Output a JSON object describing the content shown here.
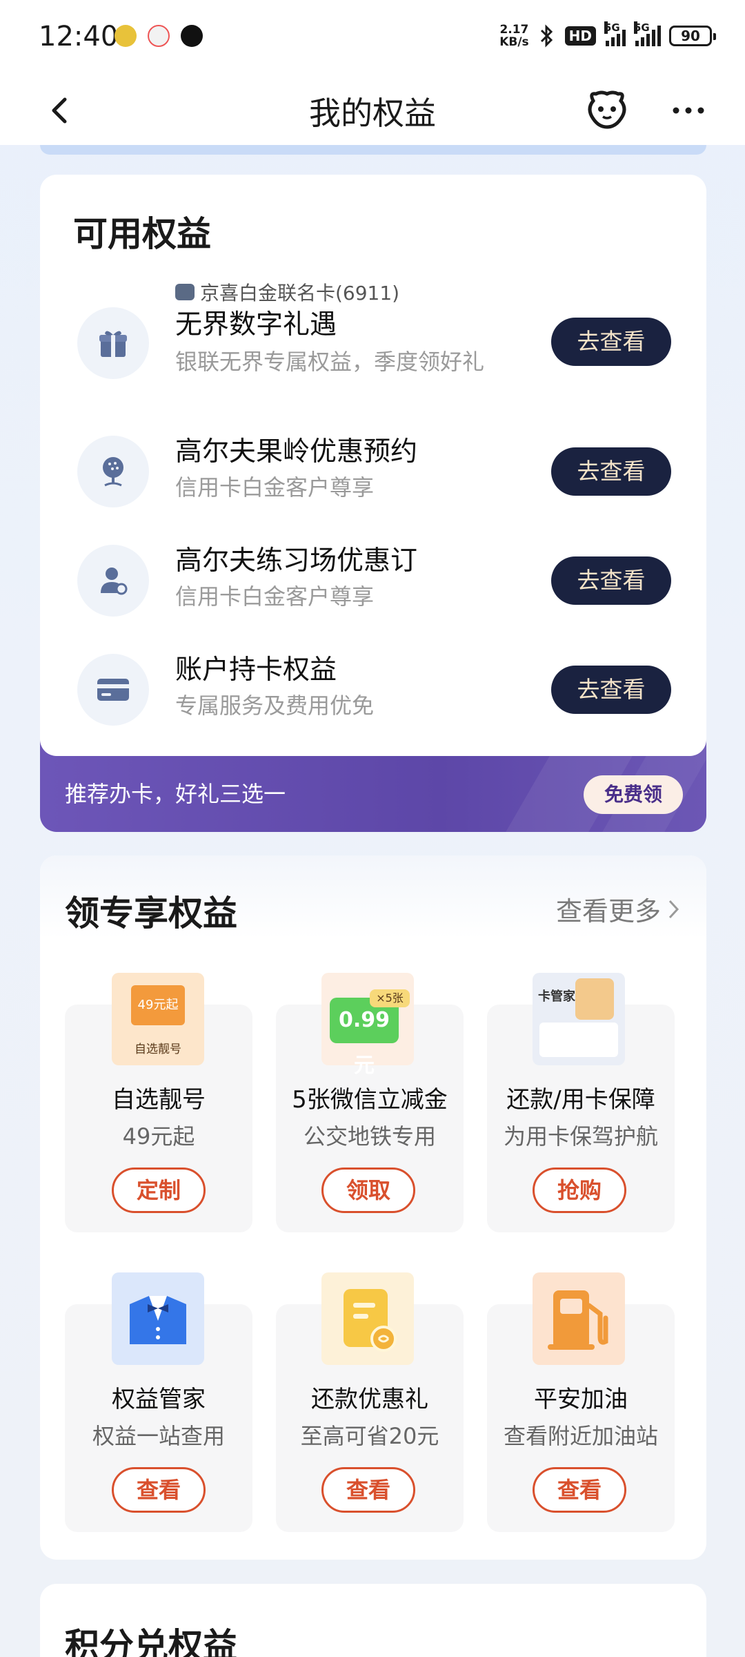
{
  "status_bar": {
    "time": "12:40",
    "net_speed_top": "2.17",
    "net_speed_bottom": "KB/s",
    "hd_label": "HD",
    "sig1": "5G",
    "sig2": "5G",
    "battery": "90"
  },
  "nav": {
    "title": "我的权益"
  },
  "available": {
    "title": "可用权益",
    "items": [
      {
        "card_tag": "京喜白金联名卡(6911)",
        "name": "无界数字礼遇",
        "desc": "银联无界专属权益，季度领好礼",
        "button": "去查看",
        "icon": "gift-icon"
      },
      {
        "name": "高尔夫果岭优惠预约",
        "desc": "信用卡白金客户尊享",
        "button": "去查看",
        "icon": "golf-ball-icon"
      },
      {
        "name": "高尔夫练习场优惠订",
        "desc": "信用卡白金客户尊享",
        "button": "去查看",
        "icon": "golfer-icon"
      },
      {
        "name": "账户持卡权益",
        "desc": "专属服务及费用优免",
        "button": "去查看",
        "icon": "card-icon"
      }
    ],
    "promo_text": "推荐办卡，好礼三选一",
    "promo_button": "免费领"
  },
  "exclusive": {
    "title": "领专享权益",
    "more": "查看更多",
    "tiles": [
      {
        "name": "自选靓号",
        "sub": "49元起",
        "button": "定制",
        "img_text_top": "49元起",
        "img_text_bottom": "自选靓号"
      },
      {
        "name": "5张微信立减金",
        "sub": "公交地铁专用",
        "button": "领取",
        "img_text_top": "×5张",
        "img_text_bottom": "0.99元"
      },
      {
        "name": "还款/用卡保障",
        "sub": "为用卡保驾护航",
        "button": "抢购",
        "img_text_top": "卡管家",
        "img_text_bottom": ""
      },
      {
        "name": "权益管家",
        "sub": "权益一站查用",
        "button": "查看"
      },
      {
        "name": "还款优惠礼",
        "sub": "至高可省20元",
        "button": "查看"
      },
      {
        "name": "平安加油",
        "sub": "查看附近加油站",
        "button": "查看"
      }
    ]
  },
  "points": {
    "title": "积分兑权益"
  },
  "colors": {
    "dark_button": "#1a2240",
    "dark_button_text": "#f4e3c8",
    "promo_purple": "#5d47a8",
    "accent_orange": "#d9502d"
  }
}
